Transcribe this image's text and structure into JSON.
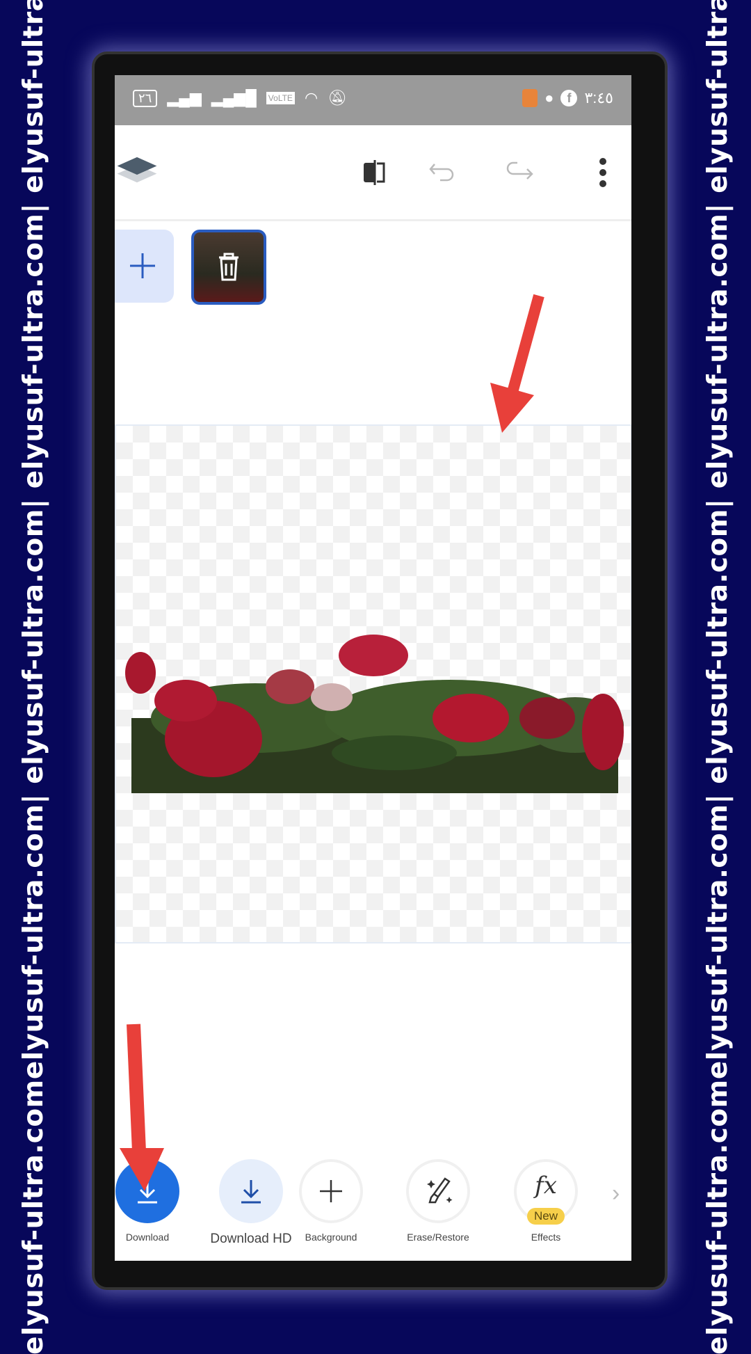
{
  "watermark": {
    "left_text": "elyusuf-ultra.comelyusuf-ultra.com| elyusuf-ultra.com| elyusuf-ultra.com| elyusuf-ultra.",
    "right_text": "elyusuf-ultra.comelyusuf-ultra.com| elyusuf-ultra.com| elyusuf-ultra.com| elyusuf-ultra."
  },
  "status_bar": {
    "battery": "٢٦",
    "network": "VoLTE",
    "time": "٣:٤٥"
  },
  "toolbar": {
    "icons": [
      "layers-icon",
      "compare-icon",
      "undo-icon",
      "redo-icon",
      "more-vertical-icon"
    ]
  },
  "bottom_tools": [
    {
      "label": "Download",
      "icon": "download-icon",
      "active": true
    },
    {
      "label": "Download HD",
      "icon": "download-icon"
    },
    {
      "label": "Background",
      "icon": "plus-icon"
    },
    {
      "label": "Erase/Restore",
      "icon": "magic-brush-icon"
    },
    {
      "label": "Effects",
      "icon": "fx-icon",
      "badge": "New"
    }
  ],
  "colors": {
    "background": "#07075a",
    "accent": "#1f6fe0",
    "arrow": "#e8403a",
    "badge": "#f6cf4a"
  }
}
